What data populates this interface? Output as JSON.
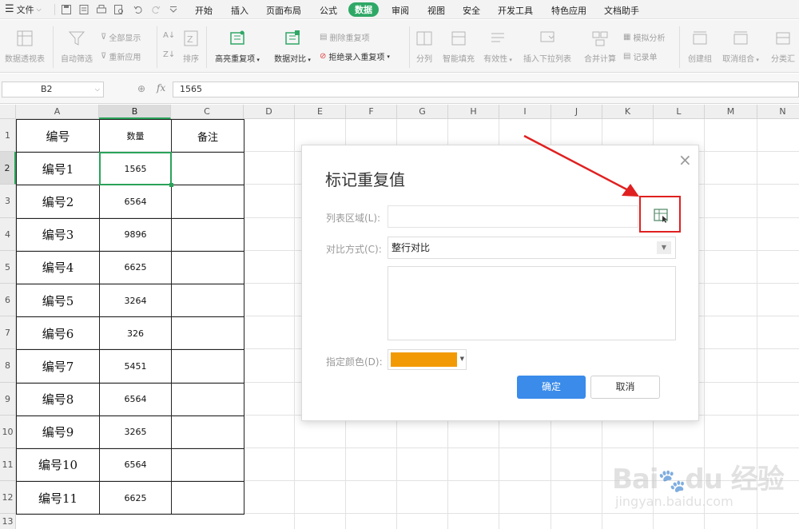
{
  "menubar": {
    "file_label": "文件",
    "tabs": [
      "开始",
      "插入",
      "页面布局",
      "公式",
      "数据",
      "审阅",
      "视图",
      "安全",
      "开发工具",
      "特色应用",
      "文档助手"
    ],
    "active_tab": "数据",
    "accent": "#2fa866"
  },
  "ribbon": {
    "pivot": "数据透视表",
    "autofilter": "自动筛选",
    "show_all": "全部显示",
    "reapply": "重新应用",
    "sort": "排序",
    "highlight_dup": "高亮重复项",
    "data_compare": "数据对比",
    "remove_dup": "删除重复项",
    "reject_dup": "拒绝录入重复项",
    "split": "分列",
    "smart_fill": "智能填充",
    "validity": "有效性",
    "dropdown_list": "插入下拉列表",
    "merge_calc": "合并计算",
    "simulate": "模拟分析",
    "record_sheet": "记录单",
    "create_group": "创建组",
    "ungroup": "取消组合",
    "subtotal": "分类汇"
  },
  "formula_bar": {
    "cell_ref": "B2",
    "fx": "fx",
    "value": "1565"
  },
  "sheet": {
    "columns": [
      "A",
      "B",
      "C",
      "D",
      "E",
      "F",
      "G",
      "H",
      "I",
      "J",
      "K",
      "L",
      "M",
      "N"
    ],
    "selected_column": "B",
    "selected_row": "2",
    "rows": [
      "1",
      "2",
      "3",
      "4",
      "5",
      "6",
      "7",
      "8",
      "9",
      "10",
      "11",
      "12"
    ],
    "partial_row": "13",
    "headers": [
      "编号",
      "数量",
      "备注"
    ],
    "data": [
      [
        "编号1",
        "1565",
        ""
      ],
      [
        "编号2",
        "6564",
        ""
      ],
      [
        "编号3",
        "9896",
        ""
      ],
      [
        "编号4",
        "6625",
        ""
      ],
      [
        "编号5",
        "3264",
        ""
      ],
      [
        "编号6",
        "326",
        ""
      ],
      [
        "编号7",
        "5451",
        ""
      ],
      [
        "编号8",
        "6564",
        ""
      ],
      [
        "编号9",
        "3265",
        ""
      ],
      [
        "编号10",
        "6564",
        ""
      ],
      [
        "编号11",
        "6625",
        ""
      ]
    ]
  },
  "dialog": {
    "title": "标记重复值",
    "range_label": "列表区域(L):",
    "range_value": "",
    "compare_label": "对比方式(C):",
    "compare_value": "整行对比",
    "color_label": "指定颜色(D):",
    "color_value": "#f29a06",
    "ok": "确定",
    "cancel": "取消",
    "highlight_color": "#e02020"
  },
  "watermark": {
    "logo": "Bai du 经验",
    "url": "jingyan.baidu.com"
  }
}
